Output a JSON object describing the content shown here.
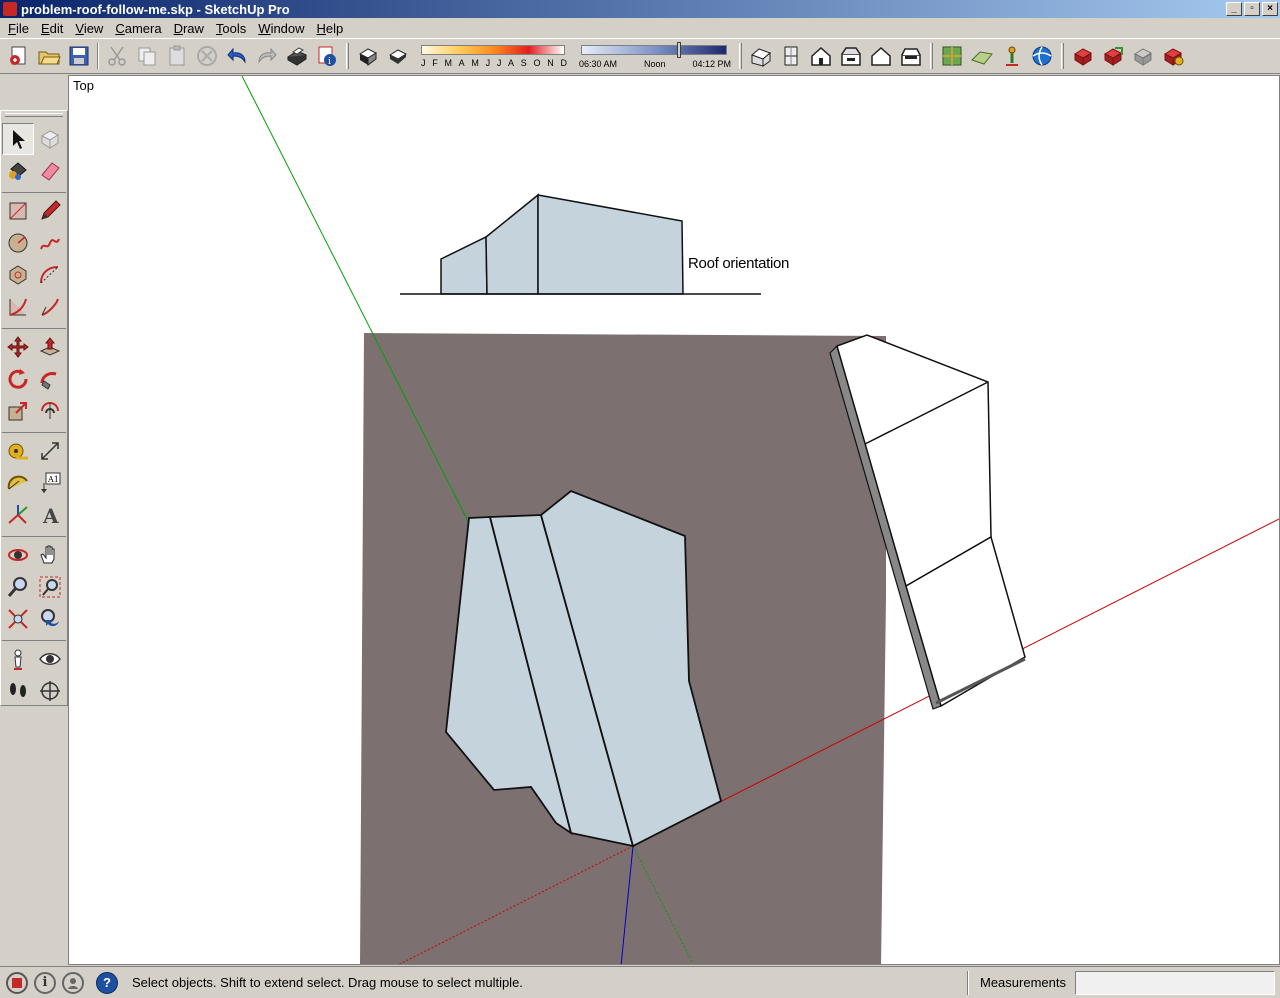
{
  "window": {
    "title": "problem-roof-follow-me.skp - SketchUp Pro",
    "controls": {
      "minimize": "_",
      "restore": "▫",
      "close": "×"
    }
  },
  "menu": [
    {
      "label": "File",
      "hotkey": "F",
      "rest": "ile"
    },
    {
      "label": "Edit",
      "hotkey": "E",
      "rest": "dit"
    },
    {
      "label": "View",
      "hotkey": "V",
      "rest": "iew"
    },
    {
      "label": "Camera",
      "hotkey": "C",
      "rest": "amera"
    },
    {
      "label": "Draw",
      "hotkey": "D",
      "rest": "raw"
    },
    {
      "label": "Tools",
      "hotkey": "T",
      "rest": "ools"
    },
    {
      "label": "Window",
      "hotkey": "W",
      "rest": "indow"
    },
    {
      "label": "Help",
      "hotkey": "H",
      "rest": "elp"
    }
  ],
  "shadow_settings": {
    "months": [
      "J",
      "F",
      "M",
      "A",
      "M",
      "J",
      "J",
      "A",
      "S",
      "O",
      "N",
      "D"
    ],
    "time_start": "06:30 AM",
    "time_mid": "Noon",
    "time_end": "04:12 PM"
  },
  "viewport": {
    "view_name": "Top",
    "annotation": "Roof orientation"
  },
  "status": {
    "message": "Select objects. Shift to extend select. Drag mouse to select multiple.",
    "measurements_label": "Measurements",
    "measurements_value": ""
  },
  "colors": {
    "ground": "#7d7070",
    "face_front": "#c5d3dd",
    "red_axis": "#cc0000",
    "green_axis": "#00a000",
    "blue_axis": "#0000cc"
  }
}
